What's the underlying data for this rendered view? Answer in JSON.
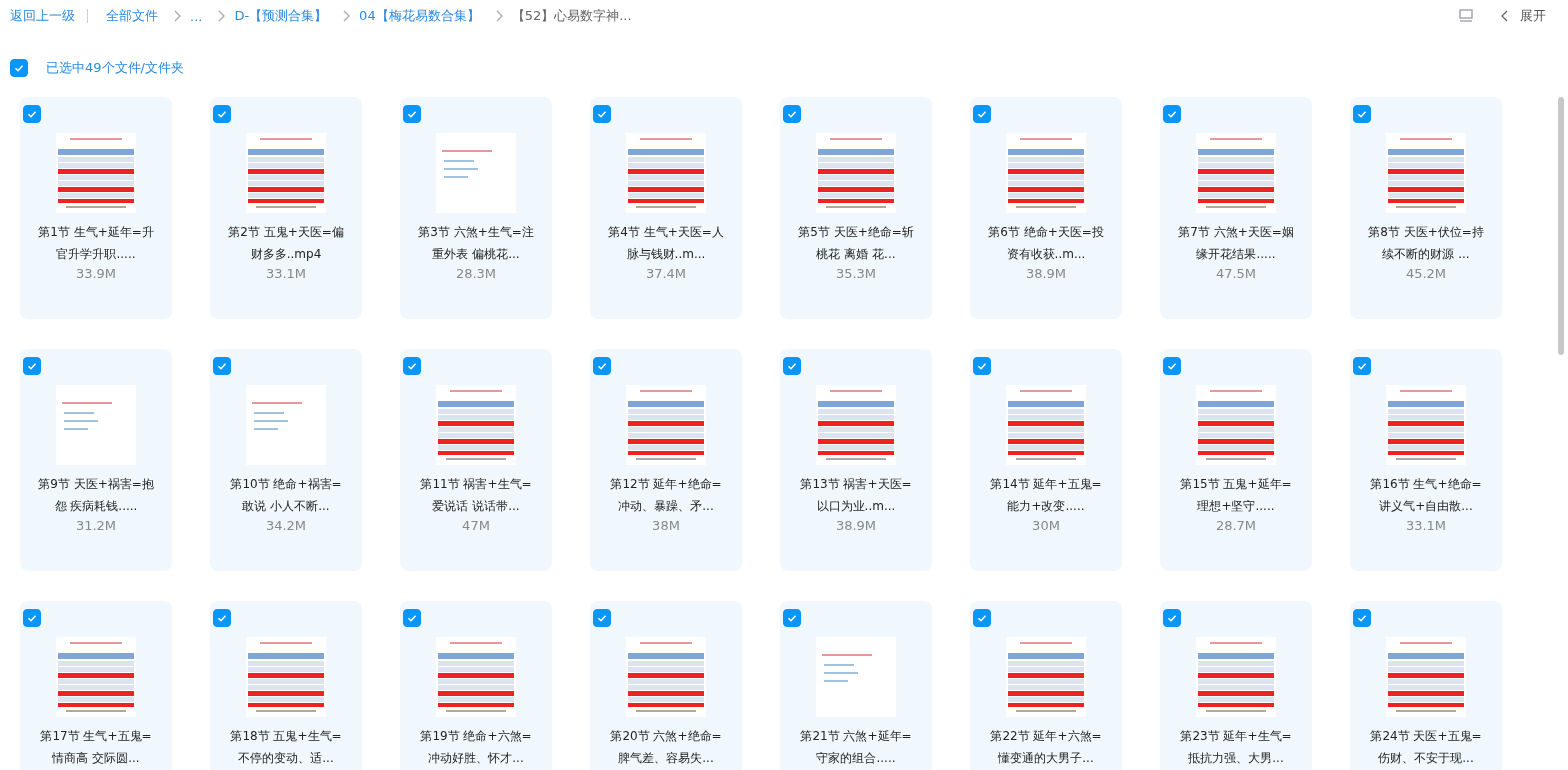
{
  "breadcrumb": {
    "back": "返回上一级",
    "items": [
      {
        "label": "全部文件",
        "current": false
      },
      {
        "label": "...",
        "current": false
      },
      {
        "label": "D-【预测合集】",
        "current": false
      },
      {
        "label": "04【梅花易数合集】",
        "current": false
      },
      {
        "label": "【52】心易数字神...",
        "current": true
      }
    ],
    "expand": "展开"
  },
  "selection": {
    "checked": true,
    "label": "已选中49个文件/文件夹"
  },
  "files": [
    {
      "name": "第1节 生气+延年=升官升学升职.....",
      "size": "33.9M",
      "checked": true,
      "kind": "table"
    },
    {
      "name": "第2节 五鬼+天医=偏财多多..mp4",
      "size": "33.1M",
      "checked": true,
      "kind": "table"
    },
    {
      "name": "第3节 六煞+生气=注重外表 偏桃花...",
      "size": "28.3M",
      "checked": true,
      "kind": "note"
    },
    {
      "name": "第4节 生气+天医=人脉与钱财..m...",
      "size": "37.4M",
      "checked": true,
      "kind": "table"
    },
    {
      "name": "第5节 天医+绝命=斩桃花 离婚 花...",
      "size": "35.3M",
      "checked": true,
      "kind": "table"
    },
    {
      "name": "第6节 绝命+天医=投资有收获..m...",
      "size": "38.9M",
      "checked": true,
      "kind": "table"
    },
    {
      "name": "第7节 六煞+天医=姻缘开花结果.....",
      "size": "47.5M",
      "checked": true,
      "kind": "table"
    },
    {
      "name": "第8节 天医+伏位=持续不断的财源 ...",
      "size": "45.2M",
      "checked": true,
      "kind": "table"
    },
    {
      "name": "第9节 天医+祸害=抱怨 疾病耗钱.....",
      "size": "31.2M",
      "checked": true,
      "kind": "note"
    },
    {
      "name": "第10节 绝命+祸害=敢说 小人不断...",
      "size": "34.2M",
      "checked": true,
      "kind": "note"
    },
    {
      "name": "第11节 祸害+生气=爱说话 说话带...",
      "size": "47M",
      "checked": true,
      "kind": "table"
    },
    {
      "name": "第12节 延年+绝命=冲动、暴躁、矛...",
      "size": "38M",
      "checked": true,
      "kind": "table"
    },
    {
      "name": "第13节 祸害+天医=以口为业..m...",
      "size": "38.9M",
      "checked": true,
      "kind": "table"
    },
    {
      "name": "第14节 延年+五鬼=能力+改变.....",
      "size": "30M",
      "checked": true,
      "kind": "table"
    },
    {
      "name": "第15节 五鬼+延年=理想+坚守.....",
      "size": "28.7M",
      "checked": true,
      "kind": "table"
    },
    {
      "name": "第16节 生气+绝命=讲义气+自由散...",
      "size": "33.1M",
      "checked": true,
      "kind": "table"
    },
    {
      "name": "第17节 生气+五鬼=情商高 交际圆...",
      "checked": true,
      "kind": "table"
    },
    {
      "name": "第18节 五鬼+生气=不停的变动、适...",
      "checked": true,
      "kind": "table"
    },
    {
      "name": "第19节 绝命+六煞=冲动好胜、怀才...",
      "checked": true,
      "kind": "table"
    },
    {
      "name": "第20节 六煞+绝命=脾气差、容易失...",
      "checked": true,
      "kind": "table"
    },
    {
      "name": "第21节 六煞+延年=守家的组合.....",
      "checked": true,
      "kind": "note"
    },
    {
      "name": "第22节 延年+六煞=懂变通的大男子...",
      "checked": true,
      "kind": "table"
    },
    {
      "name": "第23节 延年+生气=抵抗力强、大男...",
      "checked": true,
      "kind": "table"
    },
    {
      "name": "第24节 天医+五鬼=伤财、不安于现...",
      "checked": true,
      "kind": "table"
    }
  ]
}
